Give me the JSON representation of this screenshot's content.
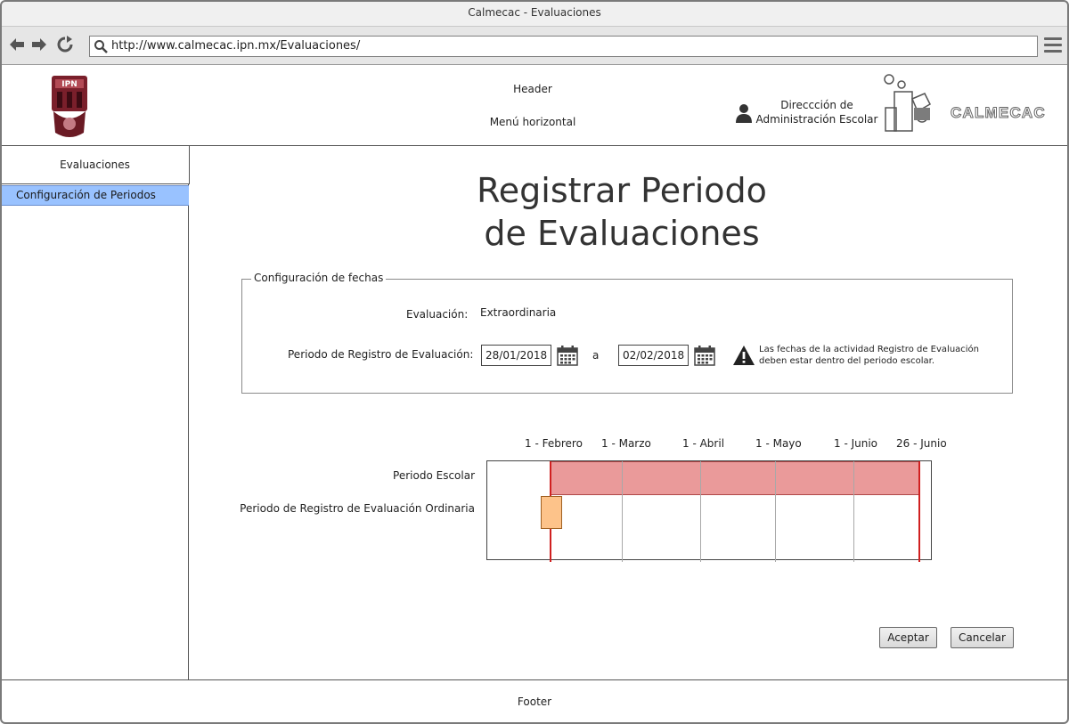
{
  "window": {
    "title": "Calmecac - Evaluaciones"
  },
  "browser": {
    "url": "http://www.calmecac.ipn.mx/Evaluaciones/",
    "icons": [
      "back-arrow-icon",
      "forward-arrow-icon",
      "reload-icon",
      "search-icon",
      "hamburger-menu-icon"
    ]
  },
  "header": {
    "header_label": "Header",
    "menu_label": "Menú horizontal",
    "user_line1": "Direccción de",
    "user_line2": "Administración Escolar",
    "brand_text": "CALMECAC"
  },
  "sidebar": {
    "title": "Evaluaciones",
    "items": [
      {
        "label": "Configuración de Periodos",
        "selected": true
      }
    ]
  },
  "main": {
    "title_line1": "Registrar Periodo",
    "title_line2": "de Evaluaciones",
    "fieldset_legend": "Configuración de fechas",
    "evaluacion_label": "Evaluación:",
    "evaluacion_value": "Extraordinaria",
    "periodo_label": "Periodo de Registro de Evaluación:",
    "date_from": "28/01/2018",
    "date_sep": "a",
    "date_to": "02/02/2018",
    "warning_line1": "Las fechas de la actividad Registro de Evaluación",
    "warning_line2": "deben estar dentro del periodo escolar."
  },
  "chart_data": {
    "type": "gantt",
    "ticks": [
      "1 - Febrero",
      "1 - Marzo",
      "1 - Abril",
      "1 - Mayo",
      "1 - Junio",
      "26 - Junio"
    ],
    "rows": [
      {
        "label": "Periodo Escolar",
        "start": "1 - Febrero",
        "end": "26 - Junio",
        "color": "#ea9a9a"
      },
      {
        "label": "Periodo de Registro de Evaluación Ordinaria",
        "start": "28/01/2018",
        "end": "02/02/2018",
        "color": "#fdc38a"
      }
    ],
    "boundary_color": "#d02020"
  },
  "buttons": {
    "accept": "Aceptar",
    "cancel": "Cancelar"
  },
  "footer": {
    "label": "Footer"
  },
  "colors": {
    "selected_item": "#99c2ff",
    "escolar_bar": "#ea9a9a",
    "ordinaria_bar": "#fdc38a"
  }
}
